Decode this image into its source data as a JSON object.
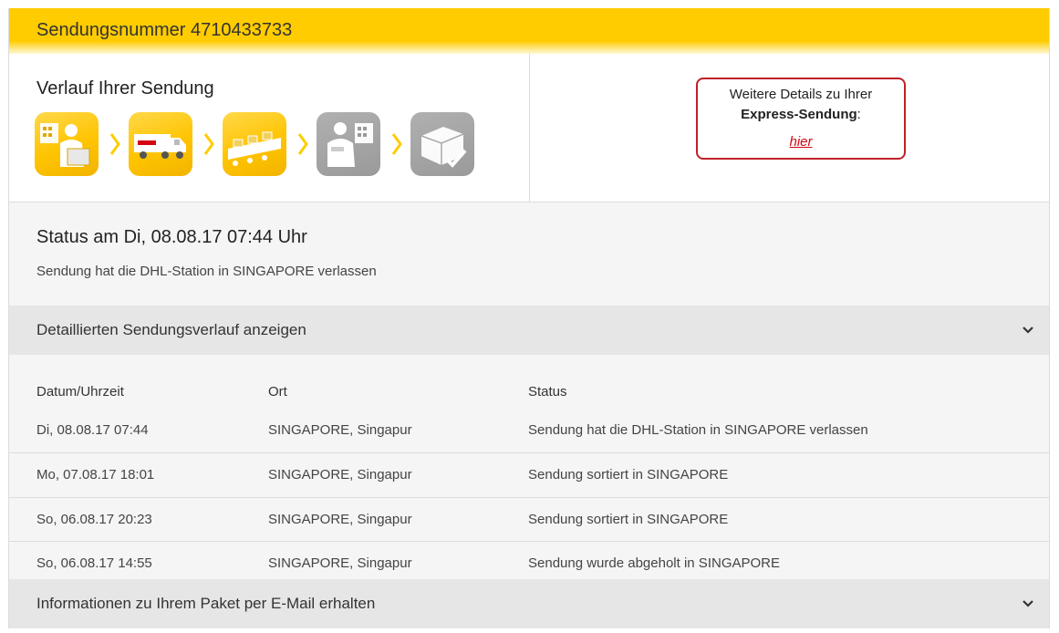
{
  "header": {
    "title": "Sendungsnummer 4710433733"
  },
  "progress": {
    "title": "Verlauf Ihrer Sendung",
    "steps": [
      {
        "icon": "pickup-courier-icon",
        "state": "done"
      },
      {
        "icon": "dhl-truck-icon",
        "state": "done"
      },
      {
        "icon": "sorting-conveyor-icon",
        "state": "done"
      },
      {
        "icon": "delivery-courier-icon",
        "state": "pending"
      },
      {
        "icon": "delivered-package-icon",
        "state": "pending"
      }
    ],
    "colors": {
      "done": "#ffc400",
      "pending": "#9e9e9e"
    }
  },
  "details_box": {
    "line1": "Weitere Details zu Ihrer",
    "line2": "Express-Sendung",
    "line2_suffix": ":",
    "link": "hier"
  },
  "status": {
    "title": "Status am Di, 08.08.17 07:44 Uhr",
    "text": "Sendung hat die DHL-Station in SINGAPORE verlassen"
  },
  "history_toggle": {
    "label": "Detaillierten Sendungsverlauf anzeigen",
    "icon": "chevron-down-icon"
  },
  "history": {
    "columns": [
      "Datum/Uhrzeit",
      "Ort",
      "Status"
    ],
    "rows": [
      [
        "Di, 08.08.17 07:44",
        "SINGAPORE, Singapur",
        "Sendung hat die DHL-Station in SINGAPORE verlassen"
      ],
      [
        "Mo, 07.08.17 18:01",
        "SINGAPORE, Singapur",
        "Sendung sortiert in SINGAPORE"
      ],
      [
        "So, 06.08.17 20:23",
        "SINGAPORE, Singapur",
        "Sendung sortiert in SINGAPORE"
      ],
      [
        "So, 06.08.17 14:55",
        "SINGAPORE, Singapur",
        "Sendung wurde abgeholt in SINGAPORE"
      ]
    ]
  },
  "email_toggle": {
    "label": "Informationen zu Ihrem Paket per E-Mail erhalten",
    "icon": "chevron-down-icon"
  },
  "colors": {
    "brand_yellow": "#ffcc00",
    "brand_red": "#d40511",
    "highlight_border": "#c0202a"
  }
}
